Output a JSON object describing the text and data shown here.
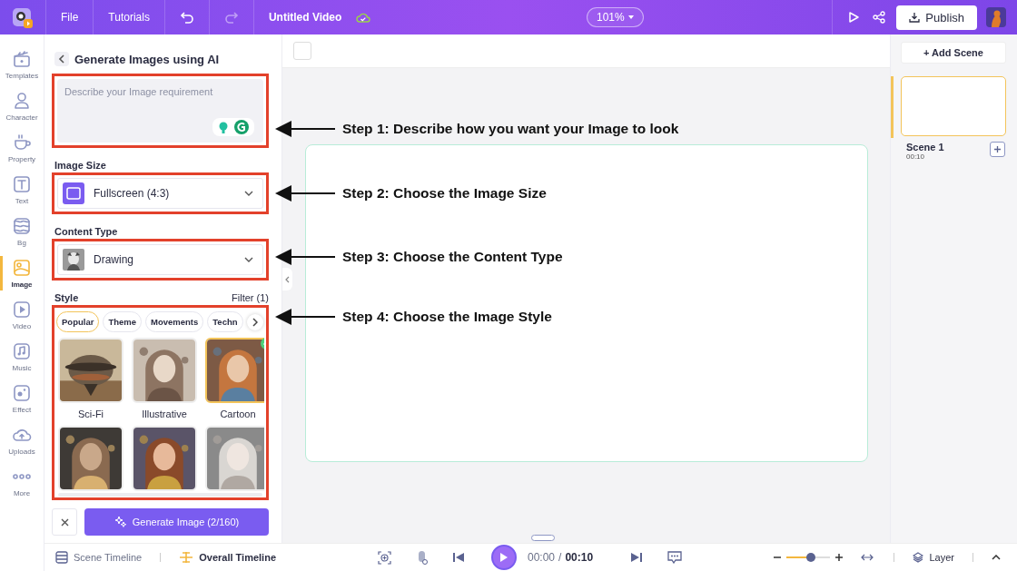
{
  "topbar": {
    "menu": [
      "File",
      "Tutorials"
    ],
    "title": "Untitled Video",
    "zoom": "101%",
    "publish": "Publish"
  },
  "rail": [
    {
      "label": "Templates",
      "selected": false
    },
    {
      "label": "Character",
      "selected": false
    },
    {
      "label": "Property",
      "selected": false
    },
    {
      "label": "Text",
      "selected": false
    },
    {
      "label": "Bg",
      "selected": false
    },
    {
      "label": "Image",
      "selected": true
    },
    {
      "label": "Video",
      "selected": false
    },
    {
      "label": "Music",
      "selected": false
    },
    {
      "label": "Effect",
      "selected": false
    },
    {
      "label": "Uploads",
      "selected": false
    },
    {
      "label": "More",
      "selected": false
    }
  ],
  "panel": {
    "title": "Generate Images using AI",
    "prompt": {
      "placeholder": "Describe your Image requirement"
    },
    "image_size": {
      "label": "Image Size",
      "value": "Fullscreen (4:3)"
    },
    "content_type": {
      "label": "Content Type",
      "value": "Drawing"
    },
    "style": {
      "label": "Style",
      "filter": "Filter (1)",
      "tabs": [
        {
          "label": "Popular",
          "selected": true
        },
        {
          "label": "Theme",
          "selected": false
        },
        {
          "label": "Movements",
          "selected": false
        },
        {
          "label": "Techn",
          "selected": false
        }
      ],
      "items": [
        {
          "label": "Sci-Fi",
          "kind": "picture",
          "selected": false
        },
        {
          "label": "Illustrative",
          "kind": "picture",
          "selected": false
        },
        {
          "label": "Cartoon",
          "kind": "picture",
          "selected": true
        },
        {
          "kind": "picture",
          "selected": false
        },
        {
          "kind": "picture",
          "selected": false
        },
        {
          "kind": "picture",
          "selected": false
        }
      ]
    },
    "generate": "Generate Image (2/160)"
  },
  "annotations": [
    {
      "text": "Step 1: Describe how you want your Image to look"
    },
    {
      "text": "Step 2: Choose the Image Size"
    },
    {
      "text": "Step 3: Choose the Content Type"
    },
    {
      "text": "Step 4: Choose the Image Style"
    }
  ],
  "scenes": {
    "add": "+ Add Scene",
    "items": [
      {
        "name": "Scene 1",
        "duration": "00:10",
        "selected": true
      }
    ]
  },
  "bottom": {
    "tabs": [
      {
        "label": "Scene Timeline",
        "selected": false
      },
      {
        "label": "Overall Timeline",
        "selected": true
      }
    ],
    "time": "00:00",
    "separator": "/",
    "total": "00:10",
    "zoom": {
      "level": 0.55
    },
    "layer": "Layer"
  }
}
